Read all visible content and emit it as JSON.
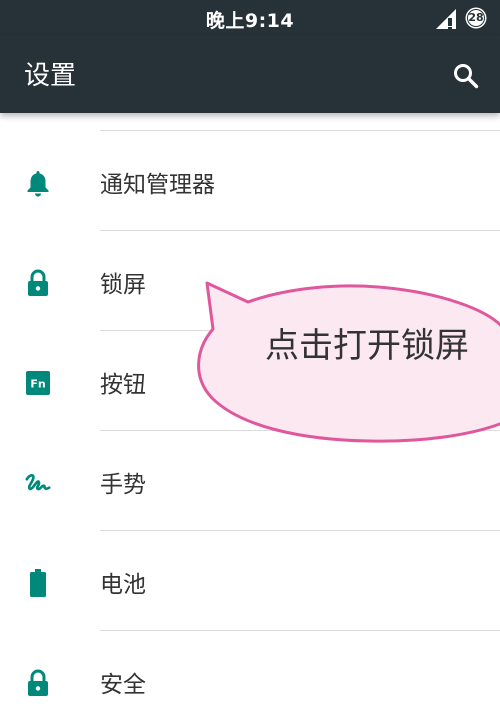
{
  "status_bar": {
    "time": "晚上9:14",
    "battery_level": "28",
    "signal_icon": "signal-icon",
    "battery_icon": "battery-circle-icon"
  },
  "app_bar": {
    "title": "设置",
    "search_icon": "search-icon"
  },
  "settings": [
    {
      "label": "通知管理器",
      "icon": "bell-icon"
    },
    {
      "label": "锁屏",
      "icon": "lock-icon"
    },
    {
      "label": "按钮",
      "icon": "fn-key-icon",
      "icon_text": "Fn"
    },
    {
      "label": "手势",
      "icon": "gesture-icon"
    },
    {
      "label": "电池",
      "icon": "battery-icon"
    },
    {
      "label": "安全",
      "icon": "lock-icon"
    }
  ],
  "callout": {
    "text": "点击打开锁屏",
    "border_color": "#e0579e",
    "fill_color": "#fbe8f1"
  },
  "colors": {
    "app_bar": "#263238",
    "accent": "#00897b",
    "divider": "#dcdcdc"
  }
}
